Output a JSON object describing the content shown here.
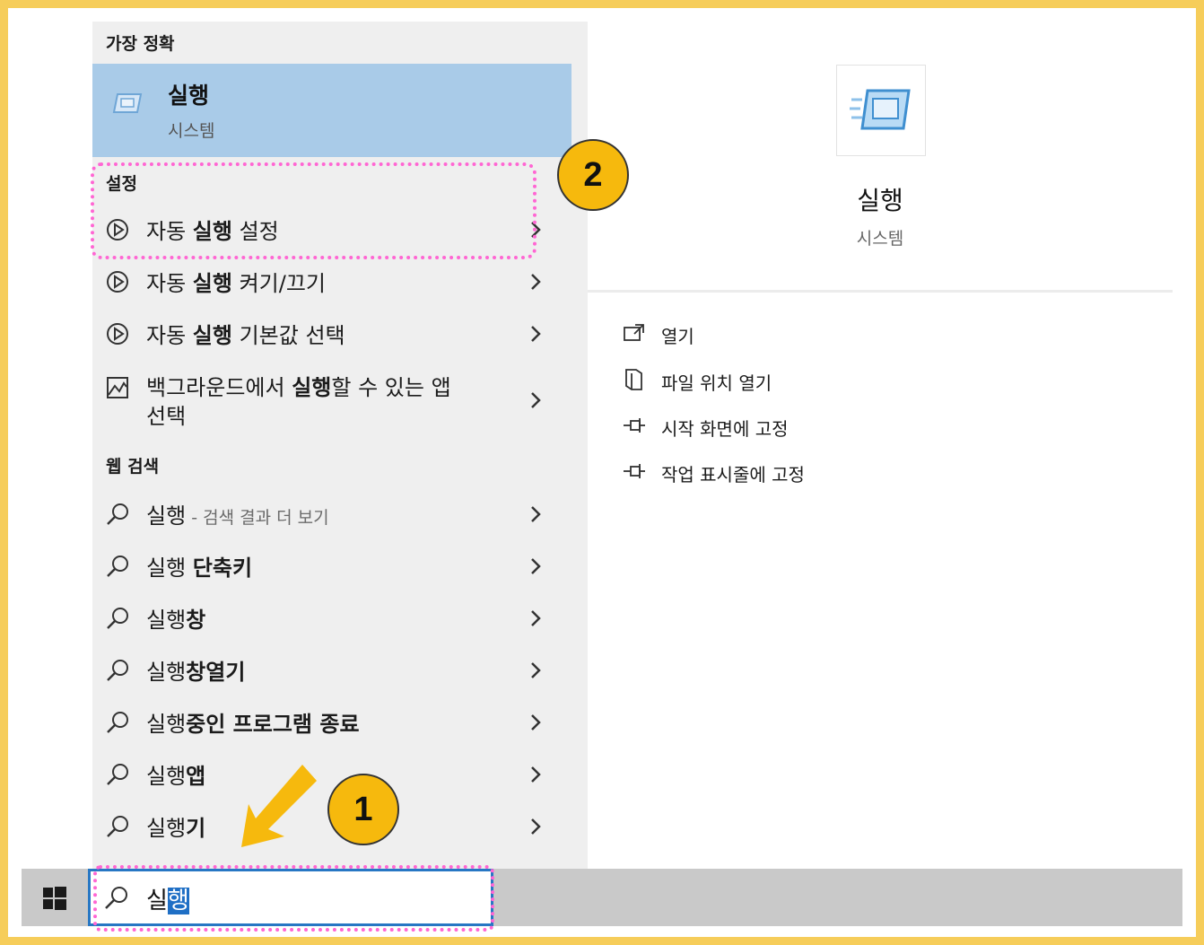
{
  "best_match": {
    "section": "가장 정확",
    "title": "실행",
    "subtitle": "시스템"
  },
  "settings": {
    "section": "설정",
    "items": [
      {
        "pre": "자동 ",
        "bold": "실행",
        "post": " 설정"
      },
      {
        "pre": "자동 ",
        "bold": "실행",
        "post": " 켜기/끄기"
      },
      {
        "pre": "자동 ",
        "bold": "실행",
        "post": " 기본값 선택"
      },
      {
        "pre": "백그라운드에서 ",
        "bold": "실행",
        "post": "할 수 있는 앱",
        "line2": "선택"
      }
    ]
  },
  "web_search": {
    "section": "웹 검색",
    "first": {
      "pre": "실행",
      "sub": " - 검색 결과 더 보기"
    },
    "items": [
      {
        "pre": "실행 ",
        "bold": "단축키"
      },
      {
        "pre": "실행",
        "bold": "창"
      },
      {
        "pre": "실행",
        "bold": "창열기"
      },
      {
        "pre": "실행",
        "bold": "중인 프로그램 종료"
      },
      {
        "pre": "실행",
        "bold": "앱"
      },
      {
        "pre": "실행",
        "bold": "기"
      }
    ]
  },
  "preview": {
    "title": "실행",
    "subtitle": "시스템",
    "actions": [
      "열기",
      "파일 위치 열기",
      "시작 화면에 고정",
      "작업 표시줄에 고정"
    ]
  },
  "search": {
    "query_plain": "실",
    "query_selected": "행"
  },
  "annotations": {
    "badge_1": "1",
    "badge_2": "2"
  },
  "colors": {
    "frame": "#f6cd5a",
    "highlight": "#a9cbe8",
    "dotted_outline": "#ff66d3",
    "badge": "#f6b90d",
    "selection": "#1f6fc5"
  }
}
